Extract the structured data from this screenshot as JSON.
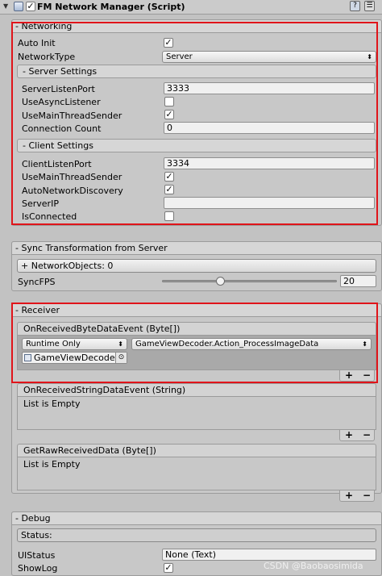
{
  "header": {
    "title": "FM Network Manager (Script)",
    "enabled": true,
    "fold_glyph": "▼",
    "buttons": [
      "?",
      "☰"
    ]
  },
  "networking": {
    "title": "- Networking",
    "auto_init_label": "Auto Init",
    "auto_init_checked": true,
    "network_type_label": "NetworkType",
    "network_type_value": "Server",
    "server_settings": {
      "title": "- Server Settings",
      "listen_port_label": "ServerListenPort",
      "listen_port_value": "3333",
      "async_listener_label": "UseAsyncListener",
      "async_listener_checked": false,
      "main_thread_label": "UseMainThreadSender",
      "main_thread_checked": true,
      "connection_count_label": "Connection Count",
      "connection_count_value": "0"
    },
    "client_settings": {
      "title": "- Client Settings",
      "listen_port_label": "ClientListenPort",
      "listen_port_value": "3334",
      "main_thread_label": "UseMainThreadSender",
      "main_thread_checked": true,
      "auto_discovery_label": "AutoNetworkDiscovery",
      "auto_discovery_checked": true,
      "server_ip_label": "ServerIP",
      "server_ip_value": "",
      "is_connected_label": "IsConnected",
      "is_connected_checked": false
    }
  },
  "sync": {
    "title": "- Sync Transformation from Server",
    "network_objects_label": "+ NetworkObjects: 0",
    "sync_fps_label": "SyncFPS",
    "sync_fps_value": "20",
    "sync_fps_fraction": 0.33
  },
  "receiver": {
    "title": "- Receiver",
    "byte_event": {
      "title": "OnReceivedByteDataEvent (Byte[])",
      "runtime_value": "Runtime Only",
      "function_value": "GameViewDecoder.Action_ProcessImageData",
      "object_value": "GameViewDecoder"
    },
    "string_event": {
      "title": "OnReceivedStringDataEvent (String)",
      "empty_text": "List is Empty"
    },
    "raw_event": {
      "title": "GetRawReceivedData (Byte[])",
      "empty_text": "List is Empty"
    },
    "add_symbol": "+",
    "remove_symbol": "−"
  },
  "debug": {
    "title": "- Debug",
    "status_label": "Status:",
    "ui_status_label": "UIStatus",
    "ui_status_value": "None (Text)",
    "show_log_label": "ShowLog",
    "show_log_checked": true
  },
  "watermark": "CSDN @Baobaosimida",
  "colors": {
    "highlight_box": "#e0141a",
    "panel_bg": "#c8c8c8",
    "field_bg": "#f0f0f0"
  }
}
